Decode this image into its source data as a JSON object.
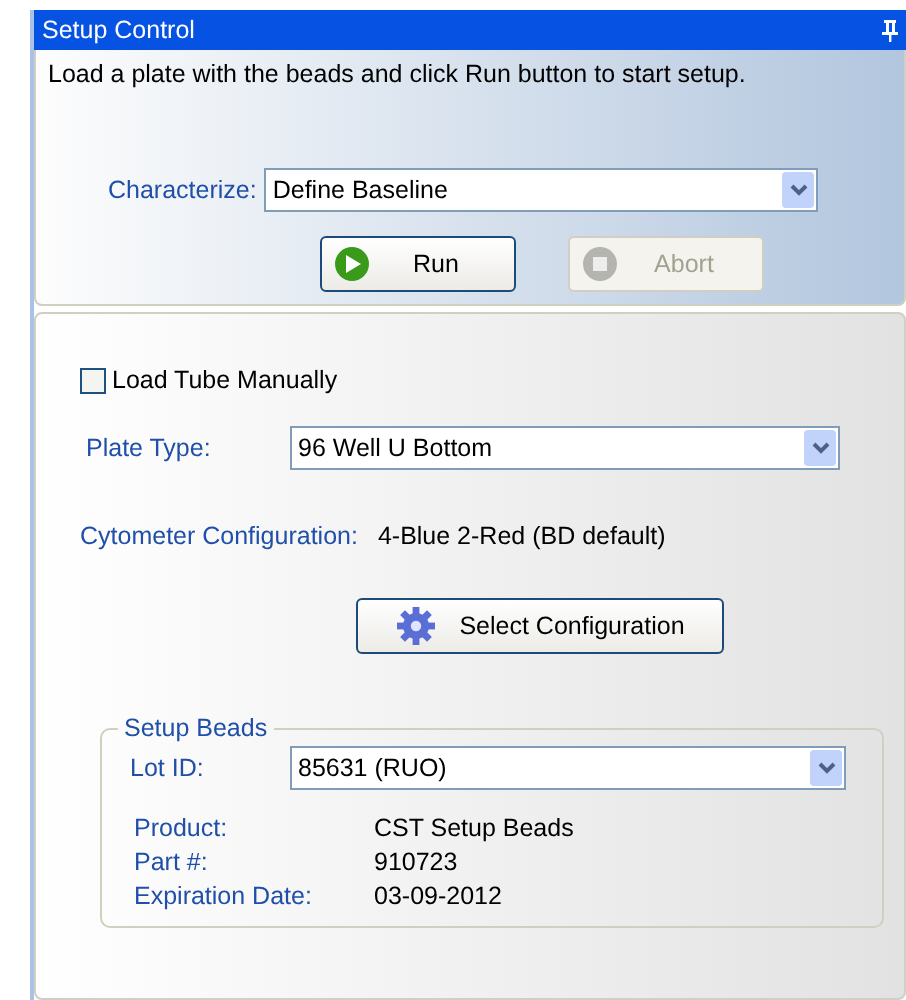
{
  "window": {
    "title": "Setup Control"
  },
  "instruction": "Load a plate with the beads and click Run button to start setup.",
  "characterize": {
    "label": "Characterize:",
    "value": "Define Baseline"
  },
  "buttons": [
    {
      "kind": "run",
      "label": "Run",
      "disabled": false
    },
    {
      "kind": "abort",
      "label": "Abort",
      "disabled": true
    }
  ],
  "load_tube": {
    "label": "Load Tube Manually",
    "checked": false
  },
  "plate_type": {
    "label": "Plate Type:",
    "value": "96 Well U Bottom"
  },
  "cytometer_configuration": {
    "label": "Cytometer Configuration:",
    "value": "4-Blue 2-Red (BD default)"
  },
  "select_configuration_button": {
    "label": "Select Configuration"
  },
  "setup_beads": {
    "title": "Setup Beads",
    "lot_id": {
      "label": "Lot ID:",
      "value": "85631 (RUO)"
    },
    "details": [
      {
        "label": "Product:",
        "value": "CST Setup Beads"
      },
      {
        "label": "Part #:",
        "value": "910723"
      },
      {
        "label": "Expiration Date:",
        "value": "03-09-2012"
      }
    ]
  }
}
